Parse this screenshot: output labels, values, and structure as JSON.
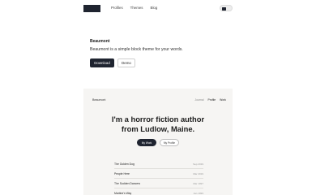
{
  "nav": {
    "links": [
      "Profiles",
      "Themes",
      "Blog"
    ]
  },
  "hero": {
    "title": "Beaumont",
    "description": "Beaumont is a simple block theme for your words.",
    "download_label": "Download",
    "demo_label": "Demo"
  },
  "preview": {
    "brand": "Beaumont",
    "nav": [
      "Journal",
      "Profile",
      "Work"
    ],
    "headline_line1": "I'm a horror fiction author",
    "headline_line2": "from Ludlow, Maine.",
    "btn_primary": "My Work",
    "btn_secondary": "My Profile",
    "rows": [
      {
        "title": "The Golden Dog",
        "date": "Sep 2019"
      },
      {
        "title": "People Here",
        "date": "Mar 2019"
      },
      {
        "title": "The Sudden Dancers",
        "date": "Mar 1997"
      },
      {
        "title": "Martine's Way",
        "date": "Jan 1993"
      }
    ]
  },
  "colors": {
    "dark": "#1f2430",
    "preview_bg": "#f6f5f3"
  }
}
